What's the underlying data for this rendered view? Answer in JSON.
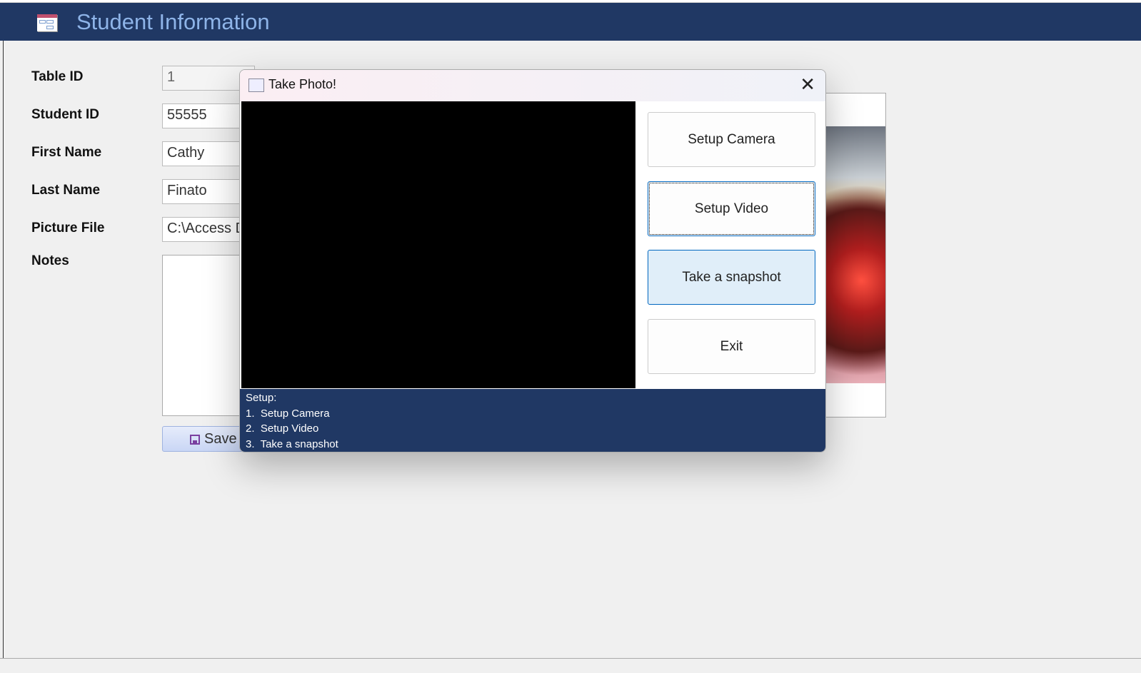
{
  "header": {
    "title": "Student Information",
    "icon": "form-icon"
  },
  "form": {
    "fields": [
      {
        "label": "Table ID",
        "value": "1"
      },
      {
        "label": "Student ID",
        "value": "55555"
      },
      {
        "label": "First Name",
        "value": "Cathy"
      },
      {
        "label": "Last Name",
        "value": "Finato"
      },
      {
        "label": "Picture File",
        "value": "C:\\Access D"
      }
    ],
    "notes_label": "Notes",
    "save_label": "Save"
  },
  "dialog": {
    "title": "Take Photo!",
    "buttons": [
      "Setup Camera",
      "Setup Video",
      "Take a snapshot",
      "Exit"
    ],
    "instructions": [
      "Setup:",
      "1.  Setup Camera",
      "2.  Setup Video",
      "3.  Take a snapshot"
    ]
  }
}
